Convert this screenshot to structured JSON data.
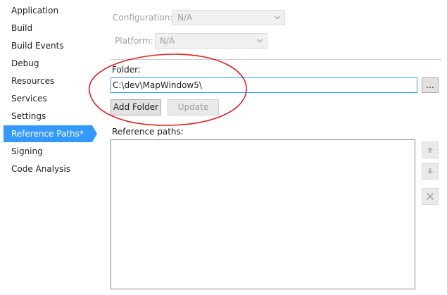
{
  "sidebar": {
    "items": [
      {
        "label": "Application"
      },
      {
        "label": "Build"
      },
      {
        "label": "Build Events"
      },
      {
        "label": "Debug"
      },
      {
        "label": "Resources"
      },
      {
        "label": "Services"
      },
      {
        "label": "Settings"
      },
      {
        "label": "Reference Paths*",
        "selected": true
      },
      {
        "label": "Signing"
      },
      {
        "label": "Code Analysis"
      }
    ]
  },
  "config": {
    "configuration_label": "Configuration:",
    "configuration_value": "N/A",
    "platform_label": "Platform:",
    "platform_value": "N/A"
  },
  "folder": {
    "label": "Folder:",
    "value": "C:\\dev\\MapWindow5\\",
    "browse_label": "...",
    "add_folder_label": "Add Folder",
    "update_label": "Update"
  },
  "reference_paths": {
    "label": "Reference paths:",
    "items": []
  },
  "icons": {
    "move_up": "arrow-up-icon",
    "move_down": "arrow-down-icon",
    "remove": "remove-x-icon",
    "dropdown": "chevron-down-icon"
  },
  "colors": {
    "selection": "#3399ff",
    "annotation": "#e02020"
  }
}
